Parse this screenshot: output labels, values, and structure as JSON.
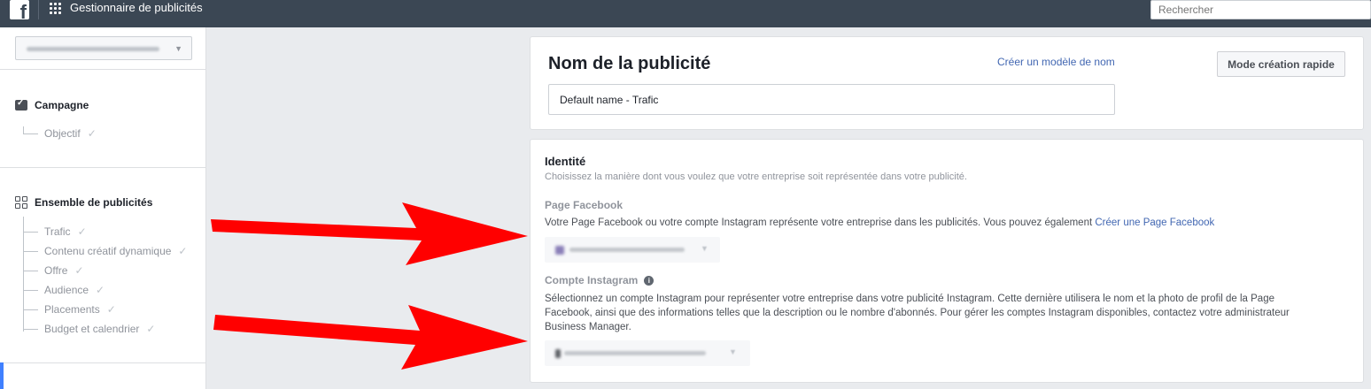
{
  "topbar": {
    "logo_letter": "f",
    "app_title": "Gestionnaire de publicités",
    "search_placeholder": "Rechercher"
  },
  "sidebar": {
    "campaign": {
      "label": "Campagne",
      "items": [
        {
          "label": "Objectif"
        }
      ]
    },
    "adset": {
      "label": "Ensemble de publicités",
      "items": [
        {
          "label": "Trafic"
        },
        {
          "label": "Contenu créatif dynamique"
        },
        {
          "label": "Offre"
        },
        {
          "label": "Audience"
        },
        {
          "label": "Placements"
        },
        {
          "label": "Budget et calendrier"
        }
      ]
    }
  },
  "ad_name_card": {
    "title": "Nom de la publicité",
    "create_template_link": "Créer un modèle de nom",
    "quick_mode_button": "Mode création rapide",
    "name_value": "Default name - Trafic"
  },
  "identity_card": {
    "title": "Identité",
    "subtitle": "Choisissez la manière dont vous voulez que votre entreprise soit représentée dans votre publicité.",
    "facebook_page": {
      "label": "Page Facebook",
      "description": "Votre Page Facebook ou votre compte Instagram représente votre entreprise dans les publicités. Vous pouvez également",
      "link": "Créer une Page Facebook"
    },
    "instagram": {
      "label": "Compte Instagram",
      "description": "Sélectionnez un compte Instagram pour représenter votre entreprise dans votre publicité Instagram. Cette dernière utilisera le nom et la photo de profil de la Page Facebook, ainsi que des informations telles que la description ou le nombre d'abonnés. Pour gérer les comptes Instagram disponibles, contactez votre administrateur Business Manager."
    }
  },
  "colors": {
    "topbar": "#3b4754",
    "link": "#4267b2",
    "arrow": "#ff0000",
    "active_indicator": "#4080ff"
  }
}
